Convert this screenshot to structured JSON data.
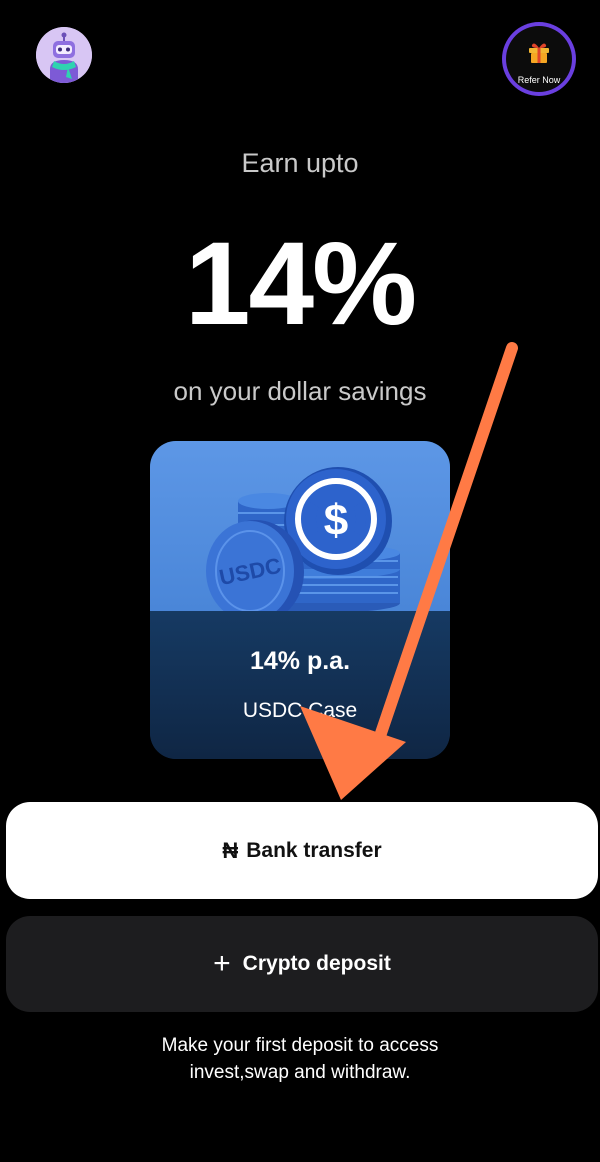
{
  "header": {
    "avatar_icon": "robot-avatar-icon",
    "refer": {
      "icon": "gift-icon",
      "label": "Refer Now",
      "accent_color": "#6a3fe0"
    }
  },
  "hero": {
    "earn_text": "Earn upto",
    "rate": "14%",
    "subtitle": "on your dollar savings"
  },
  "card": {
    "coin_label": "USDC",
    "rate": "14% p.a.",
    "name": "USDC Case"
  },
  "actions": {
    "bank_transfer": {
      "symbol": "₦",
      "label": "Bank transfer"
    },
    "crypto_deposit": {
      "symbol": "+",
      "label": "Crypto deposit"
    }
  },
  "footer": {
    "note_line1": "Make your first deposit to access",
    "note_line2": "invest,swap and withdraw."
  },
  "annotation": {
    "arrow_color": "#ff7a45"
  }
}
